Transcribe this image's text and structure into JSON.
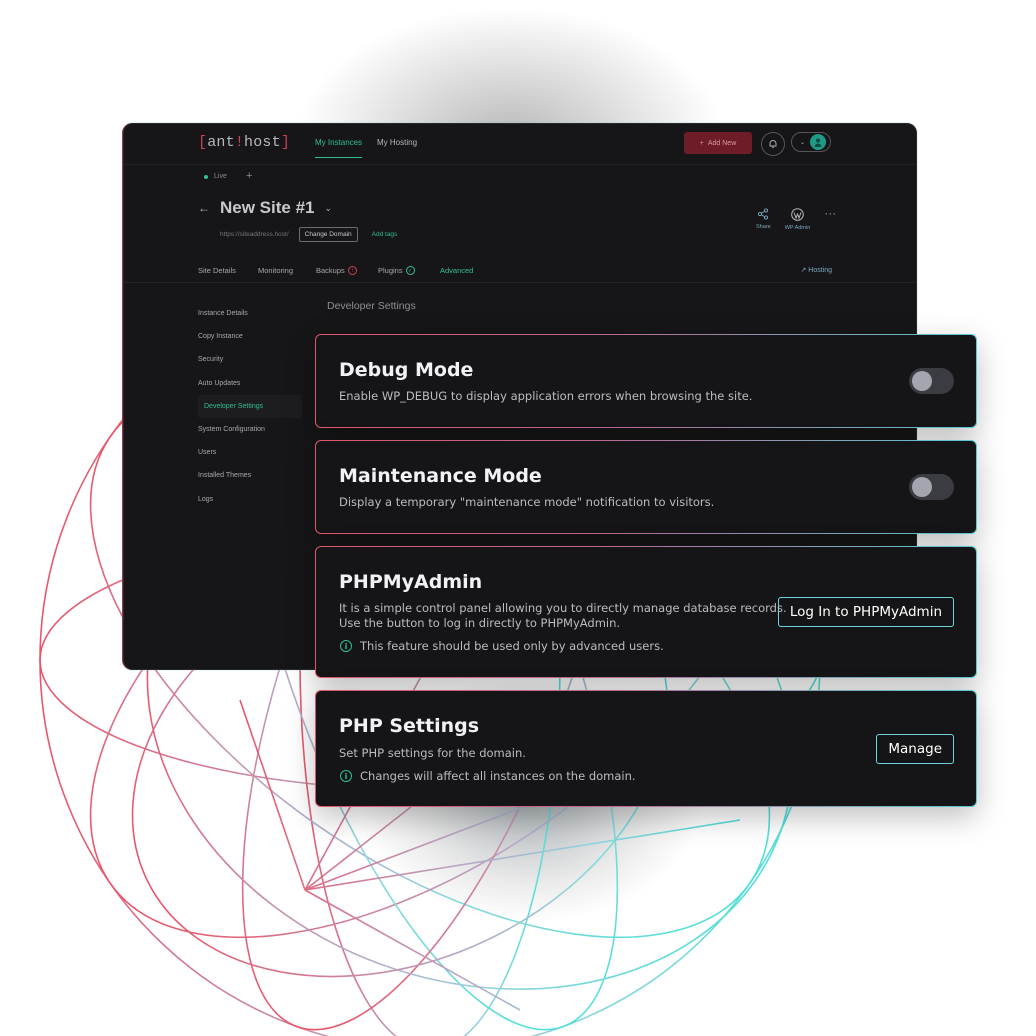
{
  "colors": {
    "accent_green": "#2fbf8f",
    "accent_red": "#c9414f",
    "card_border_start": "#e0566a",
    "card_border_end": "#58c9d4",
    "button_border": "#6fd3dd",
    "panel_bg": "#161618"
  },
  "app": {
    "logo": {
      "open": "[",
      "part1": "ant",
      "bang": "!",
      "part2": "host",
      "close": "]"
    },
    "nav": [
      "My Instances",
      "My Hosting"
    ],
    "add_new_label": "Add New",
    "status": "Live",
    "add_env_label": "+",
    "site_title": "New Site #1",
    "site_url": "https://siteaddress.host/",
    "change_domain_label": "Change Domain",
    "add_tags_label": "Add tags",
    "actions": {
      "share": "Share",
      "wp_admin": "WP Admin",
      "more": "···"
    },
    "tabs": [
      "Site Details",
      "Monitoring",
      "Backups",
      "Plugins",
      "Advanced"
    ],
    "backups_badge": "!",
    "plugins_badge": "✓",
    "hosting_link": "Hosting",
    "sidebar": [
      "Instance Details",
      "Copy Instance",
      "Security",
      "Auto Updates",
      "Developer Settings",
      "System Configuration",
      "Users",
      "Installed Themes",
      "Logs"
    ],
    "section_heading": "Developer Settings"
  },
  "cards": {
    "debug": {
      "title": "Debug Mode",
      "description": "Enable WP_DEBUG to display application errors when browsing the site.",
      "enabled": false
    },
    "maintenance": {
      "title": "Maintenance Mode",
      "description": "Display a temporary \"maintenance mode\" notification to visitors.",
      "enabled": false
    },
    "phpmyadmin": {
      "title": "PHPMyAdmin",
      "description_line1": "It is a simple control panel allowing you to directly manage database records.",
      "description_line2": "Use the button to log in directly to PHPMyAdmin.",
      "note": "This feature should be used only by advanced users.",
      "button_label": "Log In to PHPMyAdmin"
    },
    "php_settings": {
      "title": "PHP Settings",
      "description": "Set PHP settings for the domain.",
      "note": "Changes will affect all instances on the domain.",
      "button_label": "Manage"
    }
  }
}
